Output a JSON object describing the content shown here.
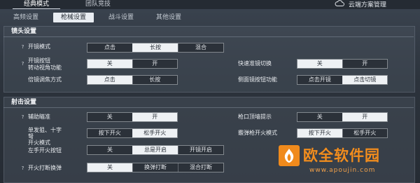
{
  "top": {
    "tabs": [
      "经典模式",
      "团队竞技"
    ],
    "cloud_label": "云端方案管理"
  },
  "subtabs": [
    "高频设置",
    "枪械设置",
    "战斗设置",
    "其他设置"
  ],
  "sections": {
    "scope": "镜头设置",
    "fire": "射击设置"
  },
  "scope_rows": {
    "open_mode": {
      "label": "开镜模式",
      "options": [
        "点击",
        "长按",
        "混合"
      ],
      "selected": "长按"
    },
    "open_button_turn": {
      "label_line1": "开镜按钮",
      "label_line2": "转动视角功能",
      "options": [
        "关",
        "开"
      ],
      "selected": "关"
    },
    "zoom_mode": {
      "label": "倍镜调焦方式",
      "options": [
        "点击",
        "长按"
      ],
      "selected": "点击"
    },
    "quick_switch": {
      "label": "快速准镜切换",
      "options": [
        "关",
        "开"
      ],
      "selected": "关"
    },
    "side_scope": {
      "label": "侧面镜按钮功能",
      "options": [
        "点击开镜",
        "点击切镜"
      ],
      "selected": "点击切镜"
    }
  },
  "fire_rows": {
    "aim_assist": {
      "label": "辅助瞄准",
      "options": [
        "关",
        "开"
      ],
      "selected": "开"
    },
    "sniper_mode": {
      "label_line1": "单发狙、十字",
      "label_line2": "弩",
      "label_line3": "开火模式",
      "options": [
        "按下开火",
        "松手开火"
      ],
      "selected": "松手开火"
    },
    "left_fire": {
      "label": "左手开火按钮",
      "options": [
        "关",
        "总是开启",
        "开镜开启"
      ],
      "selected": "总是开启"
    },
    "muzzle_hint": {
      "label": "枪口顶墙提示",
      "options": [
        "关",
        "开"
      ],
      "selected": "关"
    },
    "shotgun_mode": {
      "label": "霰弹枪开火模式",
      "options": [
        "按下开火",
        "松手开火"
      ],
      "selected": "按下开火"
    },
    "reload_interrupt": {
      "label": "开火打断换弹",
      "options": [
        "关",
        "换弹打断",
        "混合打断"
      ],
      "selected": "关"
    }
  },
  "watermark": {
    "text": "欧全软件园",
    "url": "www.apoujin.com"
  },
  "colors": {
    "accent": "#f08a1c",
    "selected_bg": "#eef1f4",
    "panel_bg": "#3b4450"
  }
}
